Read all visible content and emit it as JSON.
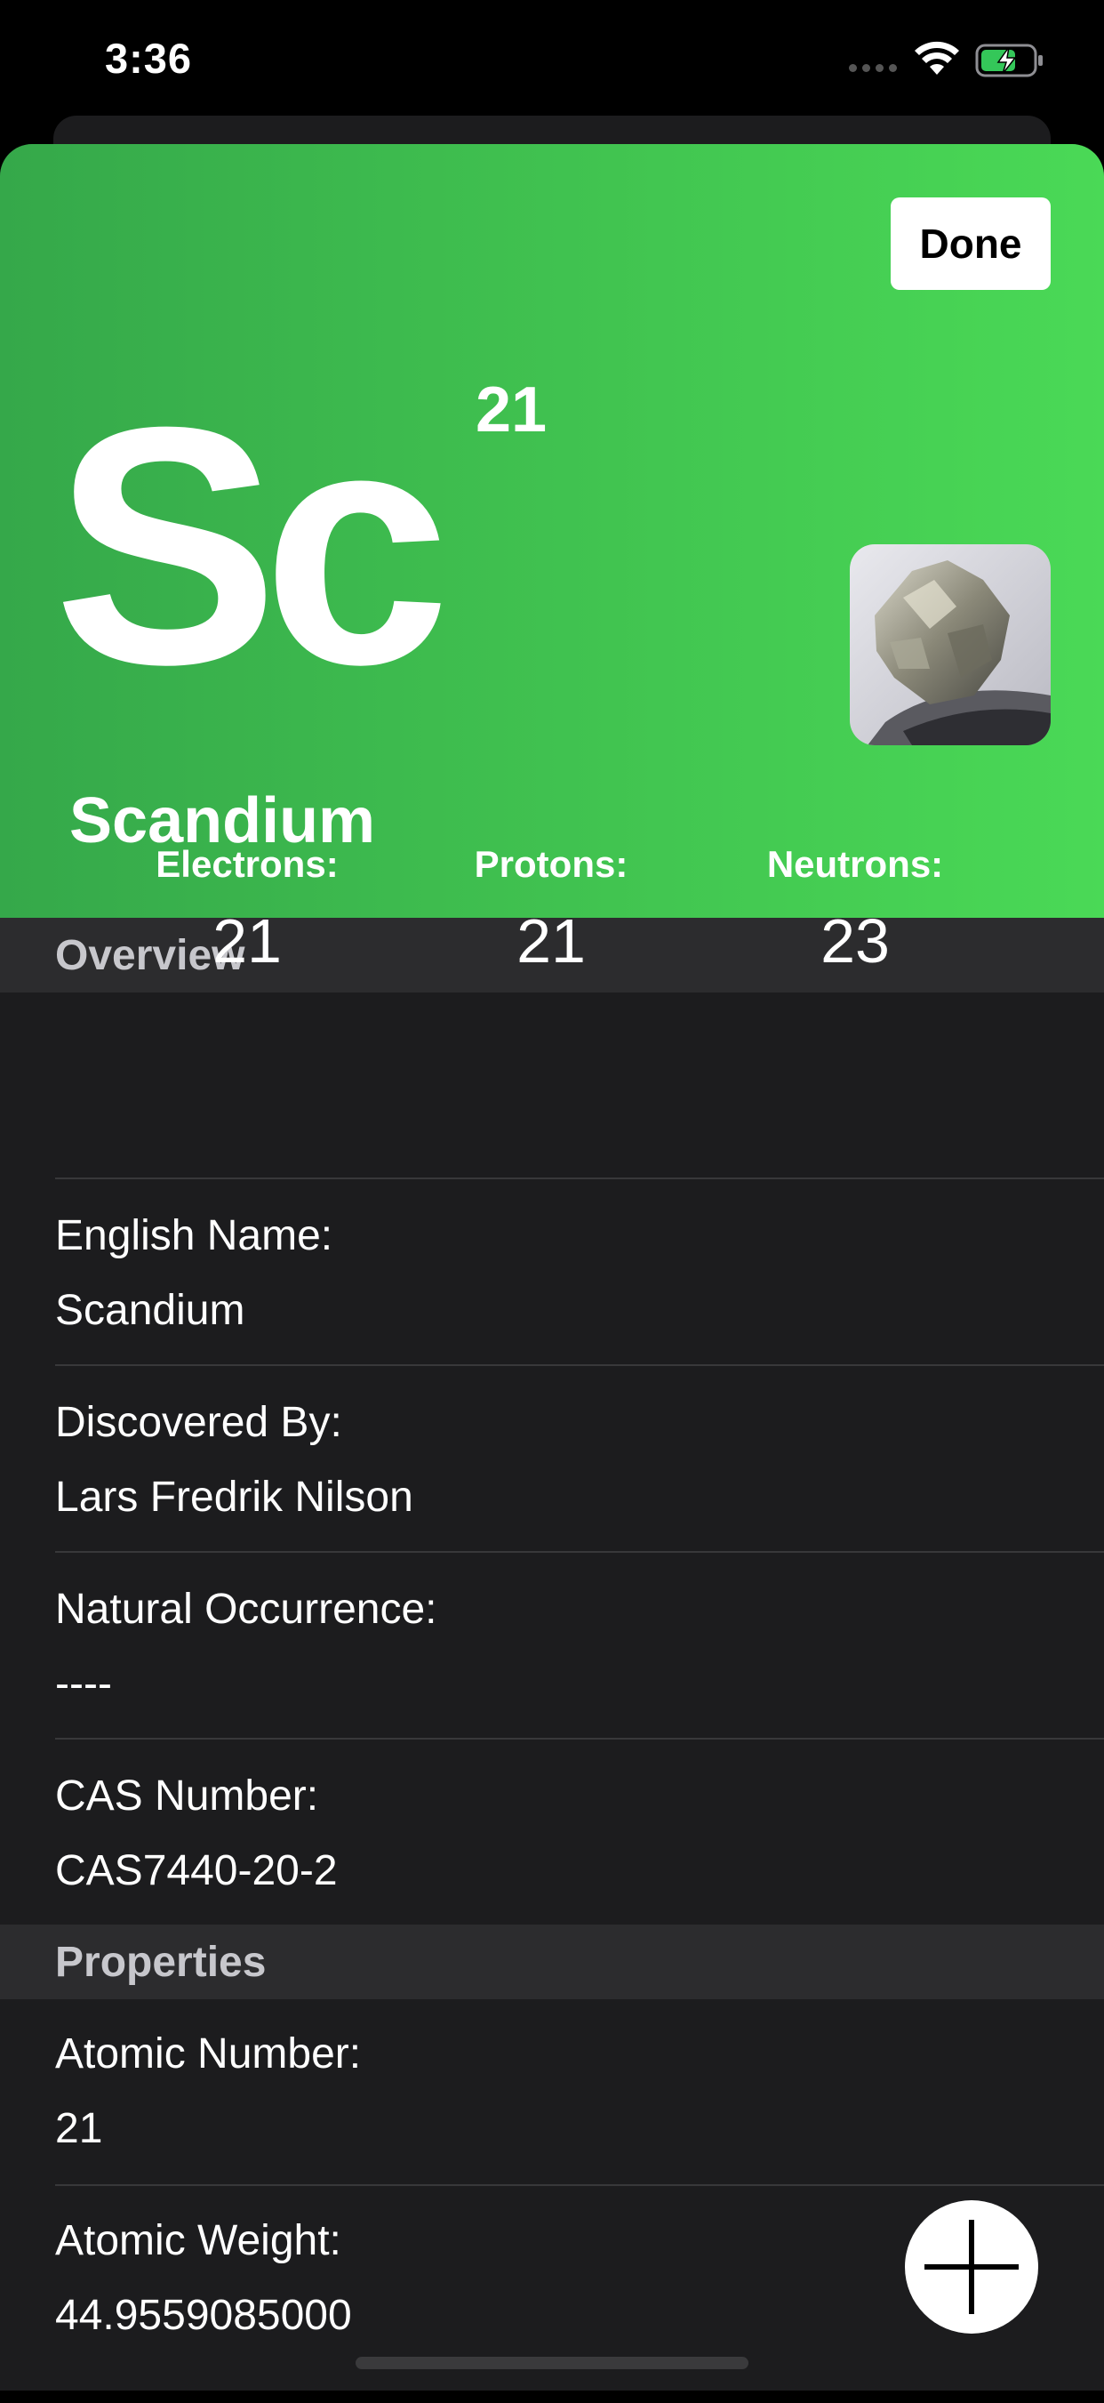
{
  "status_bar": {
    "time": "3:36"
  },
  "header": {
    "done_label": "Done",
    "atomic_number": "21",
    "symbol": "Sc",
    "name": "Scandium",
    "accent_color": "#3fbf4f"
  },
  "overview": {
    "title": "Overview",
    "stats": [
      {
        "label": "Electrons:",
        "value": "21"
      },
      {
        "label": "Protons:",
        "value": "21"
      },
      {
        "label": "Neutrons:",
        "value": "23"
      }
    ],
    "rows": [
      {
        "label": "English Name:",
        "value": "Scandium"
      },
      {
        "label": "Discovered By:",
        "value": "Lars Fredrik Nilson"
      },
      {
        "label": "Natural Occurrence:",
        "value": "----"
      },
      {
        "label": "CAS Number:",
        "value": "CAS7440-20-2"
      }
    ]
  },
  "properties": {
    "title": "Properties",
    "rows": [
      {
        "label": "Atomic Number:",
        "value": "21"
      },
      {
        "label": "Atomic Weight:",
        "value": "44.9559085000"
      }
    ]
  },
  "fab": {
    "icon": "plus-icon"
  }
}
